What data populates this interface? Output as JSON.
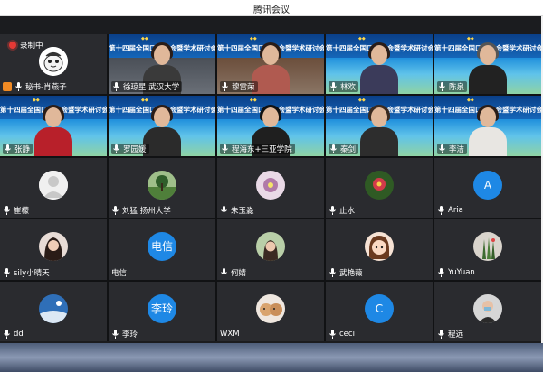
{
  "app": {
    "title": "腾讯会议"
  },
  "recording": {
    "label": "录制中"
  },
  "banner_text": "第十四届全国口译大会暨学术研讨会",
  "participants": [
    {
      "name": "秘书-肖燕子",
      "kind": "self",
      "icon": "cartoon-avatar-icon"
    },
    {
      "name": "徐琼星 武汉大学",
      "kind": "video"
    },
    {
      "name": "穆雷荣",
      "kind": "video"
    },
    {
      "name": "林欢",
      "kind": "video"
    },
    {
      "name": "陈泉",
      "kind": "video"
    },
    {
      "name": "张静",
      "kind": "video"
    },
    {
      "name": "罗园媛",
      "kind": "video"
    },
    {
      "name": "程海东+三亚学院",
      "kind": "video"
    },
    {
      "name": "秦剑",
      "kind": "video"
    },
    {
      "name": "李洁",
      "kind": "video"
    },
    {
      "name": "崔檬",
      "kind": "avatar",
      "icon": "default-user-icon"
    },
    {
      "name": "刘猛 扬州大学",
      "kind": "avatar",
      "icon": "landscape-photo-icon"
    },
    {
      "name": "朱玉淼",
      "kind": "avatar",
      "icon": "flower-photo-icon"
    },
    {
      "name": "止水",
      "kind": "avatar",
      "icon": "flower-photo-icon"
    },
    {
      "name": "Aria",
      "kind": "letter",
      "letter": "A"
    },
    {
      "name": "sily小晴天",
      "kind": "avatar",
      "icon": "portrait-photo-icon"
    },
    {
      "name": "电信",
      "kind": "letter",
      "letter": "电信"
    },
    {
      "name": "何婧",
      "kind": "avatar",
      "icon": "portrait-photo-icon"
    },
    {
      "name": "武艳薇",
      "kind": "avatar",
      "icon": "cartoon-avatar-icon"
    },
    {
      "name": "YuYuan",
      "kind": "avatar",
      "icon": "plant-photo-icon"
    },
    {
      "name": "dd",
      "kind": "avatar",
      "icon": "sky-photo-icon"
    },
    {
      "name": "李玲",
      "kind": "letter",
      "letter": "李玲"
    },
    {
      "name": "WXM",
      "kind": "avatar",
      "icon": "dog-photo-icon"
    },
    {
      "name": "ceci",
      "kind": "letter",
      "letter": "C"
    },
    {
      "name": "程远",
      "kind": "avatar",
      "icon": "portrait-photo-icon"
    }
  ]
}
